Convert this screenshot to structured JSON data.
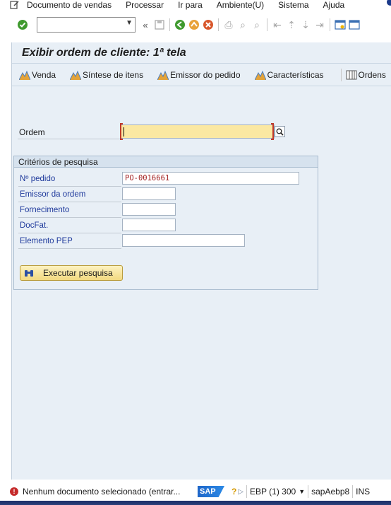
{
  "menu": {
    "items": [
      "Documento de vendas",
      "Processar",
      "Ir para",
      "Ambiente(U)",
      "Sistema",
      "Ajuda"
    ]
  },
  "toolbar": {
    "command_field_value": "",
    "icons": [
      "enter-check-icon",
      "save-icon",
      "back-icon",
      "exit-icon",
      "cancel-icon",
      "print-icon",
      "find-icon",
      "find-next-icon",
      "first-page-icon",
      "previous-page-icon",
      "next-page-icon",
      "last-page-icon",
      "new-session-icon",
      "shortcut-icon"
    ]
  },
  "page": {
    "title": "Exibir ordem de cliente: 1ª tela"
  },
  "app_toolbar": {
    "buttons": [
      {
        "label": "Venda",
        "icon": "mountain-icon"
      },
      {
        "label": "Síntese de itens",
        "icon": "mountain-icon"
      },
      {
        "label": "Emissor do pedido",
        "icon": "mountain-icon"
      },
      {
        "label": "Características",
        "icon": "mountain-icon"
      },
      {
        "label": "Ordens",
        "icon": "table-icon"
      }
    ]
  },
  "form": {
    "ordem_label": "Ordem",
    "ordem_value": ""
  },
  "search_group": {
    "title": "Critérios de pesquisa",
    "fields": [
      {
        "label": "Nº pedido",
        "value": "PO-0016661"
      },
      {
        "label": "Emissor da ordem",
        "value": ""
      },
      {
        "label": "Fornecimento",
        "value": ""
      },
      {
        "label": "DocFat.",
        "value": ""
      },
      {
        "label": "Elemento PEP",
        "value": ""
      }
    ],
    "execute_button": "Executar pesquisa"
  },
  "status": {
    "message": "Nenhum documento selecionado (entrar...",
    "system": "EBP (1) 300",
    "server": "sapAebp8",
    "mode": "INS"
  },
  "colors": {
    "frame_bg": "#e8eff6",
    "required_field": "#fbe8a2",
    "label_blue": "#1f3a9c",
    "value_red": "#a42222"
  }
}
